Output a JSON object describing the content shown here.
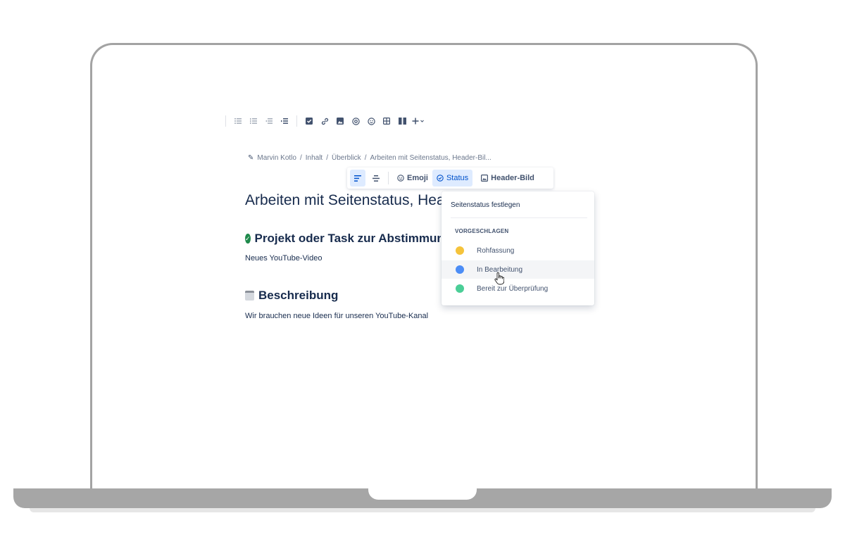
{
  "toolbar": {
    "icons": [
      "bullet-list-icon",
      "numbered-list-icon",
      "outdent-icon",
      "indent-icon",
      "task-icon",
      "link-icon",
      "image-icon",
      "mention-icon",
      "emoji-icon",
      "table-icon",
      "layout-icon",
      "insert-more-icon"
    ]
  },
  "breadcrumb": {
    "items": [
      "Marvin Kotlo",
      "Inhalt",
      "Überblick",
      "Arbeiten mit Seitenstatus, Header-Bil..."
    ],
    "separator": "/"
  },
  "title_toolbar": {
    "emoji_label": "Emoji",
    "status_label": "Status",
    "header_label": "Header-Bild"
  },
  "page": {
    "title": "Arbeiten mit Seitenstatus, Header-Bild und Emojis",
    "section1_heading": "Projekt oder Task zur Abstimmung",
    "section1_text": "Neues YouTube-Video",
    "section2_heading": "Beschreibung",
    "section2_text": "Wir brauchen neue Ideen für unseren YouTube-Kanal"
  },
  "status_dropdown": {
    "title": "Seitenstatus festlegen",
    "section_label": "VORGESCHLAGEN",
    "items": [
      {
        "label": "Rohfassung",
        "color": "#f5c33b"
      },
      {
        "label": "In Bearbeitung",
        "color": "#4c8df6"
      },
      {
        "label": "Bereit zur Überprüfung",
        "color": "#4bce97"
      }
    ],
    "hovered_index": 1
  }
}
